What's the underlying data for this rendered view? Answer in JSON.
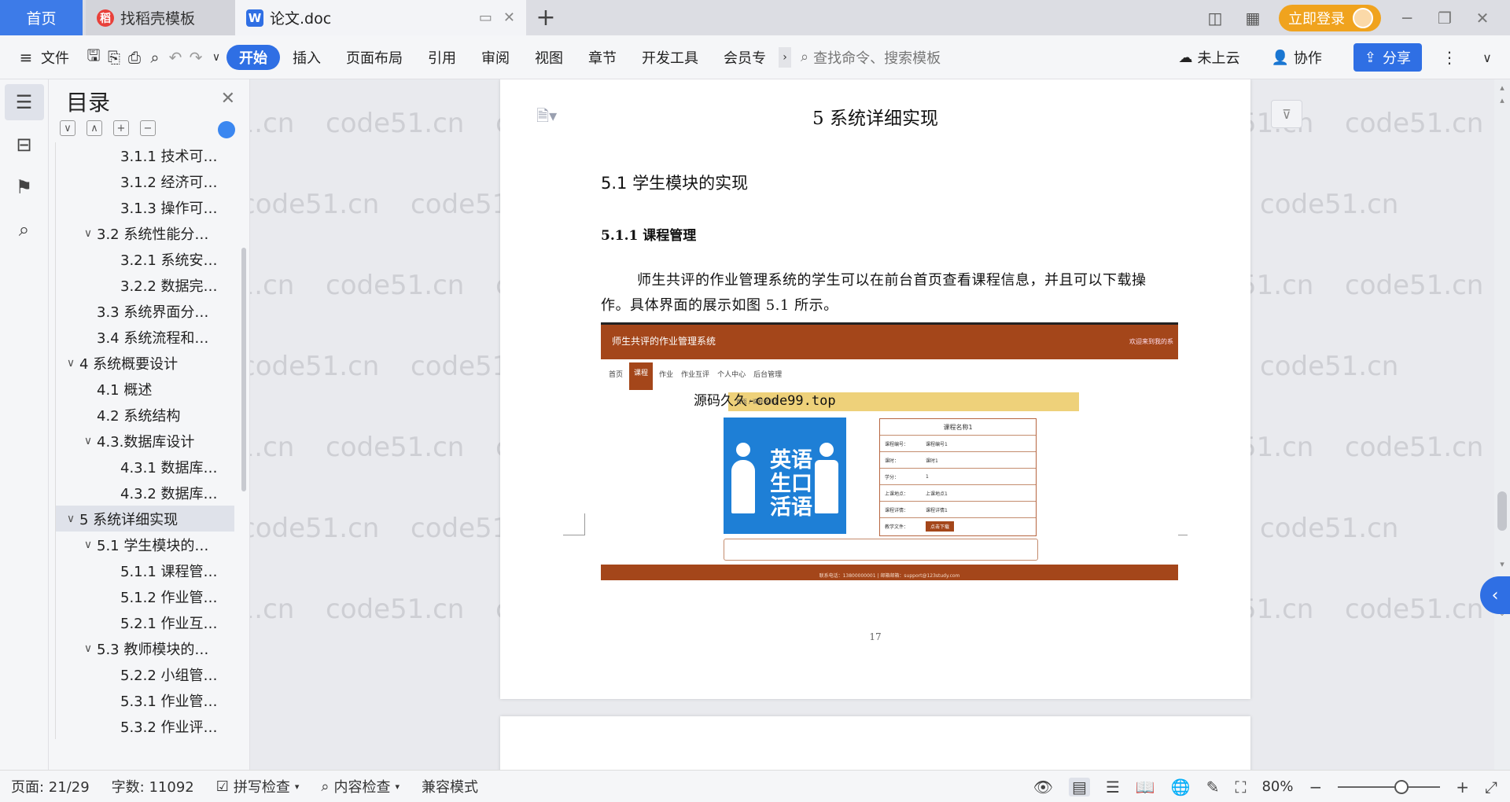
{
  "tabs": {
    "home": "首页",
    "template": "找稻壳模板",
    "doc": "论文.doc",
    "add": "+"
  },
  "titlebar": {
    "login": "立即登录"
  },
  "ribbon": {
    "file": "文件",
    "tabs": [
      "开始",
      "插入",
      "页面布局",
      "引用",
      "审阅",
      "视图",
      "章节",
      "开发工具",
      "会员专"
    ],
    "search_placeholder": "查找命令、搜索模板",
    "cloud": "未上云",
    "collab": "协作",
    "share": "分享"
  },
  "toc": {
    "title": "目录",
    "items": [
      {
        "text": "3.1.1 技术可…",
        "level": 4,
        "caret": ""
      },
      {
        "text": "3.1.2 经济可…",
        "level": 4,
        "caret": ""
      },
      {
        "text": "3.1.3 操作可…",
        "level": 4,
        "caret": ""
      },
      {
        "text": "3.2 系统性能分…",
        "level": 3,
        "caret": "∨"
      },
      {
        "text": "3.2.1  系统安…",
        "level": 4,
        "caret": ""
      },
      {
        "text": "3.2.2  数据完…",
        "level": 4,
        "caret": ""
      },
      {
        "text": "3.3 系统界面分…",
        "level": 3,
        "caret": ""
      },
      {
        "text": "3.4 系统流程和…",
        "level": 3,
        "caret": ""
      },
      {
        "text": "4 系统概要设计",
        "level": 2,
        "caret": "∨"
      },
      {
        "text": "4.1 概述",
        "level": 3,
        "caret": ""
      },
      {
        "text": "4.2 系统结构",
        "level": 3,
        "caret": ""
      },
      {
        "text": "4.3.数据库设计",
        "level": 3,
        "caret": "∨"
      },
      {
        "text": "4.3.1 数据库…",
        "level": 4,
        "caret": ""
      },
      {
        "text": "4.3.2 数据库…",
        "level": 4,
        "caret": ""
      },
      {
        "text": "5 系统详细实现",
        "level": 2,
        "caret": "∨",
        "selected": true
      },
      {
        "text": "5.1  学生模块的…",
        "level": 3,
        "caret": "∨"
      },
      {
        "text": "5.1.1  课程管…",
        "level": 4,
        "caret": ""
      },
      {
        "text": "5.1.2  作业管…",
        "level": 4,
        "caret": ""
      },
      {
        "text": "5.2.1  作业互…",
        "level": 4,
        "caret": ""
      },
      {
        "text": "5.3  教师模块的…",
        "level": 3,
        "caret": "∨"
      },
      {
        "text": "5.2.2  小组管…",
        "level": 4,
        "caret": ""
      },
      {
        "text": "5.3.1  作业管…",
        "level": 4,
        "caret": ""
      },
      {
        "text": "5.3.2  作业评…",
        "level": 4,
        "caret": ""
      }
    ]
  },
  "document": {
    "chapter_title": "5 系统详细实现",
    "section_title": "5.1  学生模块的实现",
    "subsection_title": "5.1.1  课程管理",
    "paragraph": "师生共评的作业管理系统的学生可以在前台首页查看课程信息，并且可以下载操作。具体界面的展示如图 5.1 所示。",
    "page_number": "17",
    "watermark": "code51.cn"
  },
  "figure": {
    "site_title": "师生共评的作业管理系统",
    "welcome": "欢迎来到我的系",
    "nav": [
      "首页",
      "课程",
      "作业",
      "作业互评",
      "个人中心",
      "后台管理"
    ],
    "crumb": "首页  /  课程名称1",
    "overlay": "源码久久-code99.top",
    "image_text": "英语生口活语",
    "form_title": "课程名称1",
    "rows": [
      {
        "label": "课程编号：",
        "value": "课程编号1"
      },
      {
        "label": "课时：",
        "value": "课时1"
      },
      {
        "label": "学分：",
        "value": "1"
      },
      {
        "label": "上课地点：",
        "value": "上课地点1"
      },
      {
        "label": "课程详情：",
        "value": "课程详情1"
      }
    ],
    "file_label": "教学文件：",
    "download": "点击下载",
    "footer": "联系电话：13800000001 | 邮箱邮箱：support@123study.com"
  },
  "statusbar": {
    "page": "页面: 21/29",
    "words": "字数: 11092",
    "spell": "拼写检查",
    "content": "内容检查",
    "compat": "兼容模式",
    "zoom": "80%"
  }
}
